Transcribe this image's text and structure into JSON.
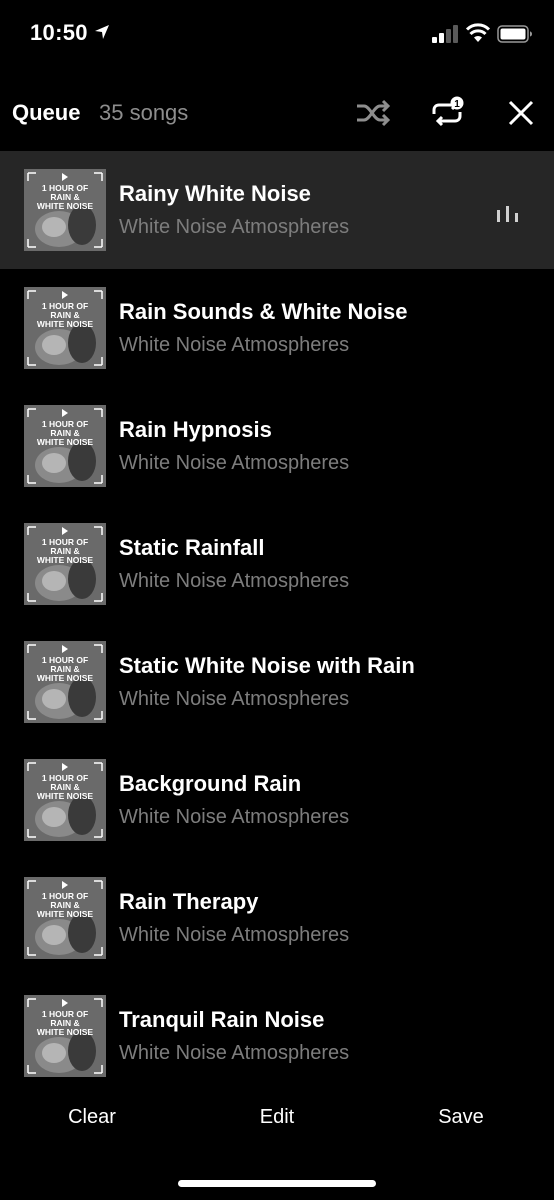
{
  "status_bar": {
    "time": "10:50"
  },
  "header": {
    "title": "Queue",
    "count": "35 songs",
    "repeat_badge": "1"
  },
  "album_art": {
    "text_line1": "1 HOUR OF",
    "text_line2": "RAIN &",
    "text_line3": "WHITE NOISE"
  },
  "songs": [
    {
      "title": "Rainy White Noise",
      "artist": "White Noise Atmospheres",
      "playing": true
    },
    {
      "title": "Rain Sounds & White Noise",
      "artist": "White Noise Atmospheres"
    },
    {
      "title": "Rain Hypnosis",
      "artist": "White Noise Atmospheres"
    },
    {
      "title": "Static Rainfall",
      "artist": "White Noise Atmospheres"
    },
    {
      "title": "Static White Noise with Rain",
      "artist": "White Noise Atmospheres"
    },
    {
      "title": "Background Rain",
      "artist": "White Noise Atmospheres"
    },
    {
      "title": "Rain Therapy",
      "artist": "White Noise Atmospheres"
    },
    {
      "title": "Tranquil Rain Noise",
      "artist": "White Noise Atmospheres"
    }
  ],
  "footer": {
    "clear": "Clear",
    "edit": "Edit",
    "save": "Save"
  },
  "colors": {
    "background": "#000000",
    "current_row": "#262626",
    "secondary_text": "#7d7d7d"
  },
  "icons": {
    "location": "location-arrow-icon",
    "signal": "cellular-signal-icon",
    "wifi": "wifi-icon",
    "battery": "battery-icon",
    "shuffle": "shuffle-icon",
    "repeat": "repeat-one-icon",
    "close": "close-icon",
    "now_playing": "equalizer-icon"
  }
}
